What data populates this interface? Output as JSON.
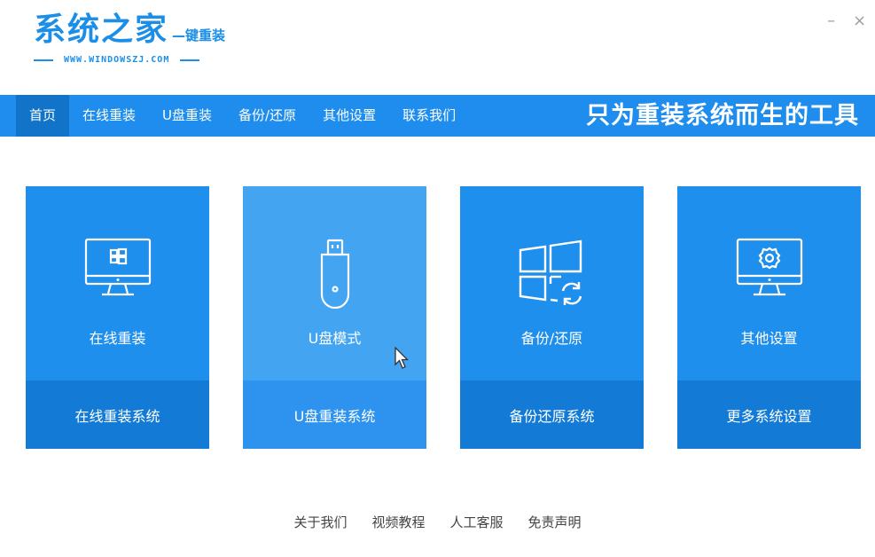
{
  "header": {
    "logo_title": "系统之家",
    "logo_sub": "—键重装",
    "logo_url": "WWW.WINDOWSZJ.COM",
    "minimize_label": "–",
    "close_label": "×"
  },
  "nav": {
    "items": [
      {
        "label": "首页",
        "active": true
      },
      {
        "label": "在线重装"
      },
      {
        "label": "U盘重装"
      },
      {
        "label": "备份/还原"
      },
      {
        "label": "其他设置"
      },
      {
        "label": "联系我们"
      }
    ],
    "slogan": "只为重装系统而生的工具"
  },
  "cards": [
    {
      "label": "在线重装",
      "sub": "在线重装系统",
      "icon": "monitor-windows-icon"
    },
    {
      "label": "U盘模式",
      "sub": "U盘重装系统",
      "icon": "usb-drive-icon",
      "hover": true
    },
    {
      "label": "备份/还原",
      "sub": "备份还原系统",
      "icon": "windows-refresh-icon"
    },
    {
      "label": "其他设置",
      "sub": "更多系统设置",
      "icon": "monitor-gear-icon"
    }
  ],
  "footer": {
    "links": [
      "关于我们",
      "视频教程",
      "人工客服",
      "免责声明"
    ]
  },
  "colors": {
    "brand": "#1e8ded",
    "nav_active": "#1274c9",
    "card": "#1f8fee",
    "card_bottom": "#137bd6",
    "card_hover": "#43a4f2"
  }
}
